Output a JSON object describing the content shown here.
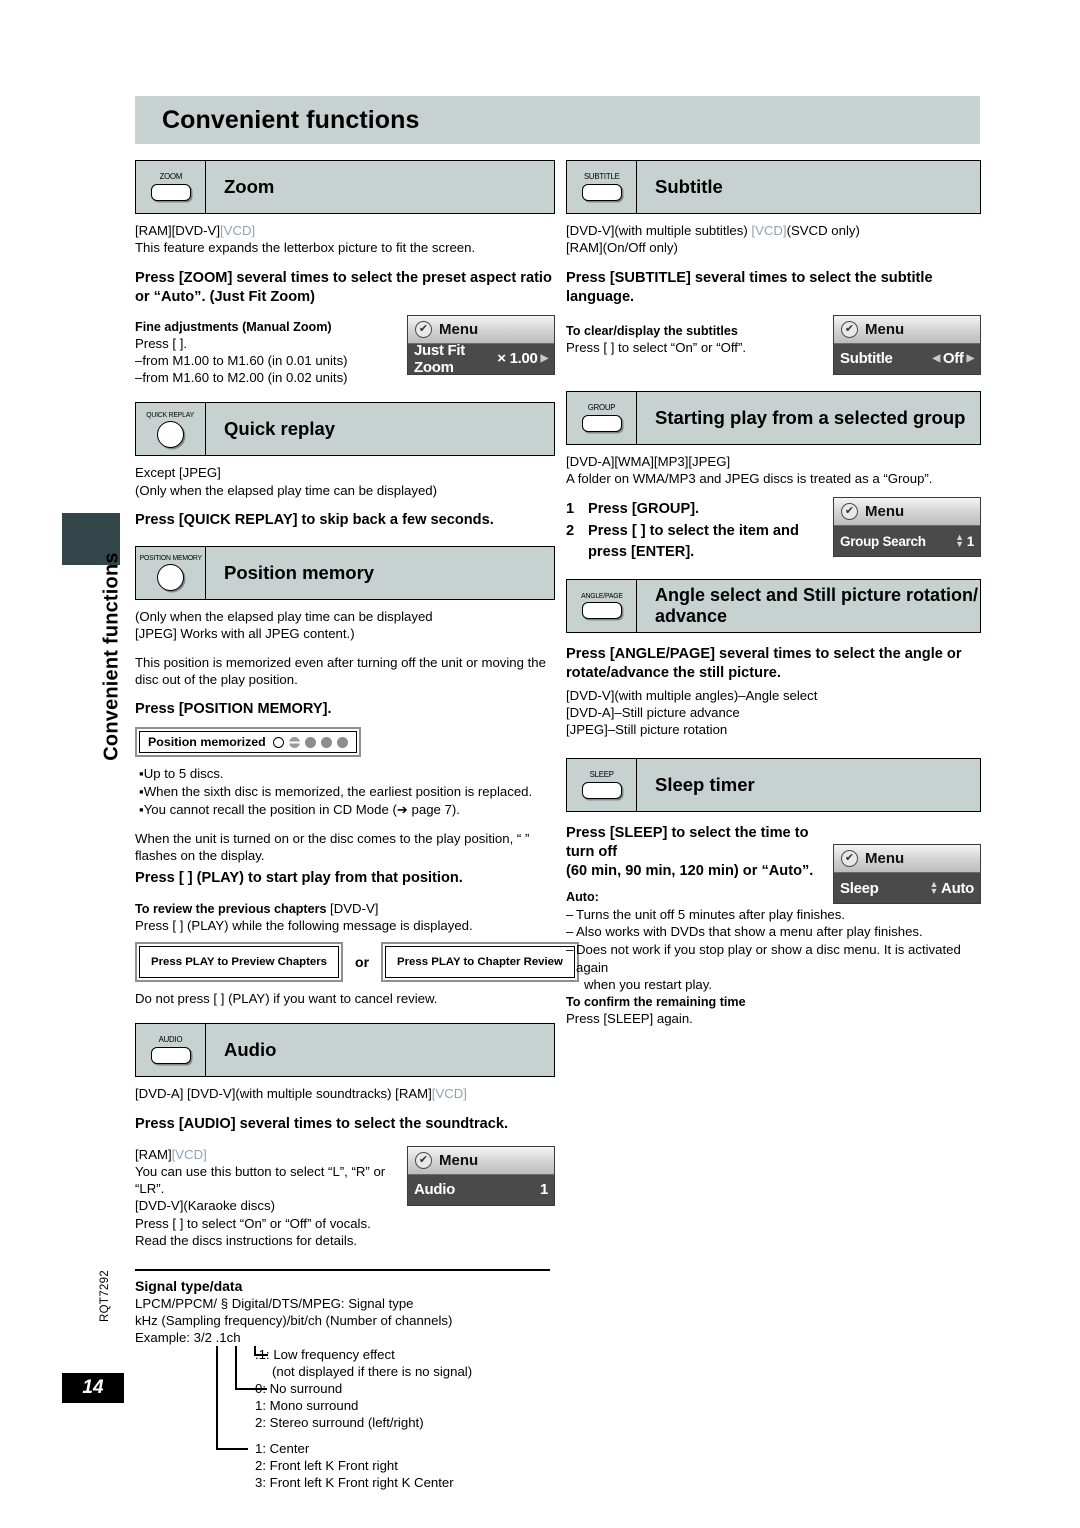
{
  "page": {
    "banner_title": "Convenient functions",
    "side_vertical_text": "Convenient functions",
    "rqt_code": "RQT7292",
    "page_number": "14"
  },
  "menu_widget": {
    "header_title": "Menu",
    "check_glyph": "✔"
  },
  "sections": {
    "zoom": {
      "button_label": "ZOOM",
      "title": "Zoom",
      "tags": "[RAM][DVD-V]",
      "tags_vcd": "[VCD]",
      "intro": "This feature expands the letterbox picture to fit the screen.",
      "instruction_l1": "Press [ZOOM] several times to select the preset aspect ratio",
      "instruction_l2": "or “Auto”. (Just Fit Zoom)",
      "fine_heading": "Fine adjustments (Manual Zoom)",
      "fine_press": "Press [        ].",
      "fine_range1": "–from  M1.00 to  M1.60 (in 0.01 units)",
      "fine_range2": "–from  M1.60 to  M2.00 (in 0.02 units)",
      "osd_item": "Just Fit Zoom",
      "osd_value": "× 1.00"
    },
    "quick_replay": {
      "button_label": "QUICK REPLAY",
      "title": "Quick replay",
      "tag_line": "Except [JPEG]",
      "note": "(Only when the elapsed play time can be displayed)",
      "instruction": "Press [QUICK REPLAY] to skip back a few seconds."
    },
    "position_memory": {
      "button_label": "POSITION MEMORY",
      "title": "Position memory",
      "note_l1": "(Only when the elapsed play time can be displayed",
      "note_l2": "[JPEG] Works with all JPEG content.)",
      "para_l1": "This position is memorized even after turning off the unit or moving the",
      "para_l2": "disc out of the play position.",
      "instruction": "Press [POSITION MEMORY].",
      "display_text": "Position memorized",
      "bullets": [
        "Up to 5 discs.",
        "When the sixth disc is memorized, the earliest position is replaced.",
        "You cannot recall the position in CD Mode (➔ page 7)."
      ],
      "after_l1": "When the unit is turned on or the disc comes to the play position, “     ”",
      "after_l2": "flashes on the display.",
      "play_instruction": "Press [     ] (PLAY) to start play from that position.",
      "review_heading": "To review the previous chapters",
      "review_tag": "[DVD-V]",
      "review_line": "Press [    ] (PLAY) while the following message is displayed.",
      "msg_left": "Press PLAY to Preview Chapters",
      "msg_or": "or",
      "msg_right": "Press PLAY to Chapter Review",
      "cancel_line": "Do not press [    ] (PLAY) if you want to cancel review."
    },
    "audio": {
      "button_label": "AUDIO",
      "title": "Audio",
      "tags_l1_a": "[DVD-A] [DVD-V](with multiple soundtracks) [RAM]",
      "tags_l1_vcd": "[VCD]",
      "instruction": "Press [AUDIO] several times to select the soundtrack.",
      "tags_l2": "[RAM]",
      "tags_l2_vcd": "[VCD]",
      "body_l1": "You can use this button to select “L”, “R” or “LR”.",
      "body_l2": "[DVD-V](Karaoke discs)",
      "body_l3": "Press [        ] to select “On” or “Off” of vocals.",
      "body_l4": "Read the discs instructions for details.",
      "osd_item": "Audio",
      "osd_value": "1"
    },
    "signal": {
      "heading": "Signal type/data",
      "line1": "LPCM/PPCM/ §   Digital/DTS/MPEG:  Signal type",
      "line2": "kHz (Sampling frequency)/bit/ch (Number of channels)",
      "line3": "Example: 3/2 .1ch",
      "items": [
        ".1: Low frequency effect",
        "(not displayed if there is no signal)",
        "0: No surround",
        "1: Mono surround",
        "2: Stereo surround (left/right)",
        "1: Center",
        "2: Front left K Front right",
        "3: Front left K Front right K Center"
      ]
    },
    "subtitle": {
      "button_label": "SUBTITLE",
      "title": "Subtitle",
      "tags_l1_a": "[DVD-V](with multiple subtitles) ",
      "tags_l1_vcd": "[VCD]",
      "tags_l1_b": "(SVCD only)",
      "tags_l2": "[RAM](On/Off only)",
      "instruction_l1": "Press [SUBTITLE] several times to select the subtitle",
      "instruction_l2": "language.",
      "clear_heading": "To clear/display the subtitles",
      "clear_line": "Press [        ] to select “On” or “Off”.",
      "osd_item": "Subtitle",
      "osd_value": "Off"
    },
    "group": {
      "button_label": "GROUP",
      "title": "Starting play from a selected group",
      "tags": "[DVD-A][WMA][MP3][JPEG]",
      "note": "A folder on WMA/MP3 and JPEG discs is treated as a “Group”.",
      "step1_n": "1",
      "step1": "Press [GROUP].",
      "step2_n": "2",
      "step2_l1": "Press [        ] to select the item and",
      "step2_l2": "press [ENTER].",
      "osd_item": "Group Search",
      "osd_value": "1"
    },
    "angle": {
      "button_label": "ANGLE/PAGE",
      "title_l1": "Angle select and Still picture rotation/",
      "title_l2": "advance",
      "instruction_l1": "Press [ANGLE/PAGE] several times to select the angle or",
      "instruction_l2": "rotate/advance the still picture.",
      "items": [
        "[DVD-V](with multiple angles)–Angle select",
        "[DVD-A]–Still picture advance",
        "[JPEG]–Still picture rotation"
      ]
    },
    "sleep": {
      "button_label": "SLEEP",
      "title": "Sleep timer",
      "instruction_l1": "Press [SLEEP] to select the time to turn off",
      "instruction_l2": "(60 min, 90 min, 120 min) or “Auto”.",
      "auto_heading": "Auto:",
      "auto_items": [
        "Turns the unit off 5 minutes after play finishes.",
        "Also works with DVDs that show a menu after play finishes.",
        "Does not work if you stop play or show a disc menu. It is activated again"
      ],
      "auto_cont": "when you restart play.",
      "confirm_heading": "To confirm the remaining time",
      "confirm_line": "Press [SLEEP] again.",
      "osd_item": "Sleep",
      "osd_value": "Auto"
    }
  }
}
